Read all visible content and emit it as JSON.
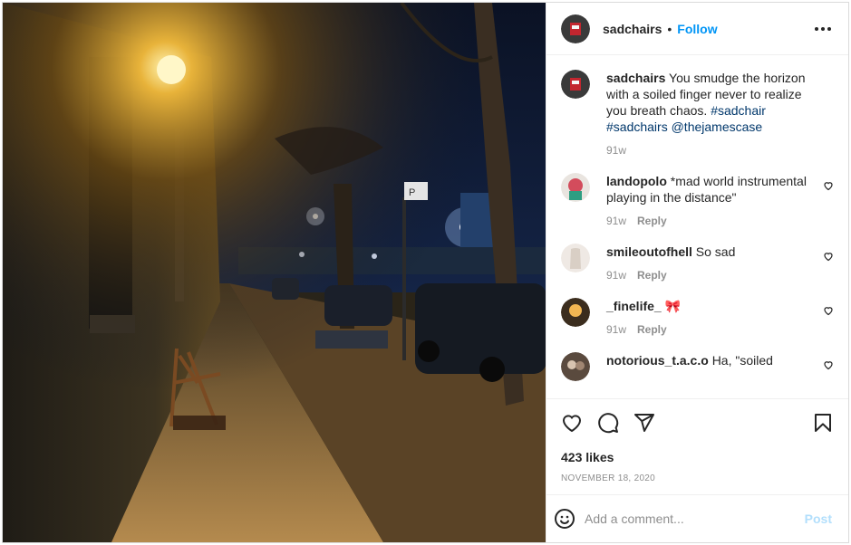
{
  "header": {
    "username": "sadchairs",
    "separator": "•",
    "follow_label": "Follow",
    "more_icon": "more-horizontal-icon"
  },
  "caption": {
    "username": "sadchairs",
    "text": "You smudge the horizon with a soiled finger never to realize you breath chaos.",
    "tags": [
      "#sadchair",
      "#sadchairs",
      "@thejamescase"
    ],
    "time": "91w"
  },
  "comments": [
    {
      "username": "landopolo",
      "text": "*mad world instrumental playing in the distance\"",
      "time": "91w",
      "reply_label": "Reply"
    },
    {
      "username": "smileoutofhell",
      "text": "So sad",
      "time": "91w",
      "reply_label": "Reply"
    },
    {
      "username": "_finelife_",
      "text": "🎀",
      "time": "91w",
      "reply_label": "Reply"
    },
    {
      "username": "notorious_t.a.c.o",
      "text": "Ha, \"soiled",
      "time": "",
      "reply_label": ""
    }
  ],
  "likes": "423 likes",
  "date": "NOVEMBER 18, 2020",
  "comment_input": {
    "placeholder": "Add a comment..."
  },
  "post_label": "Post",
  "colors": {
    "accent": "#0095f6",
    "post_disabled": "#b2dffc",
    "tag": "#00376b"
  }
}
